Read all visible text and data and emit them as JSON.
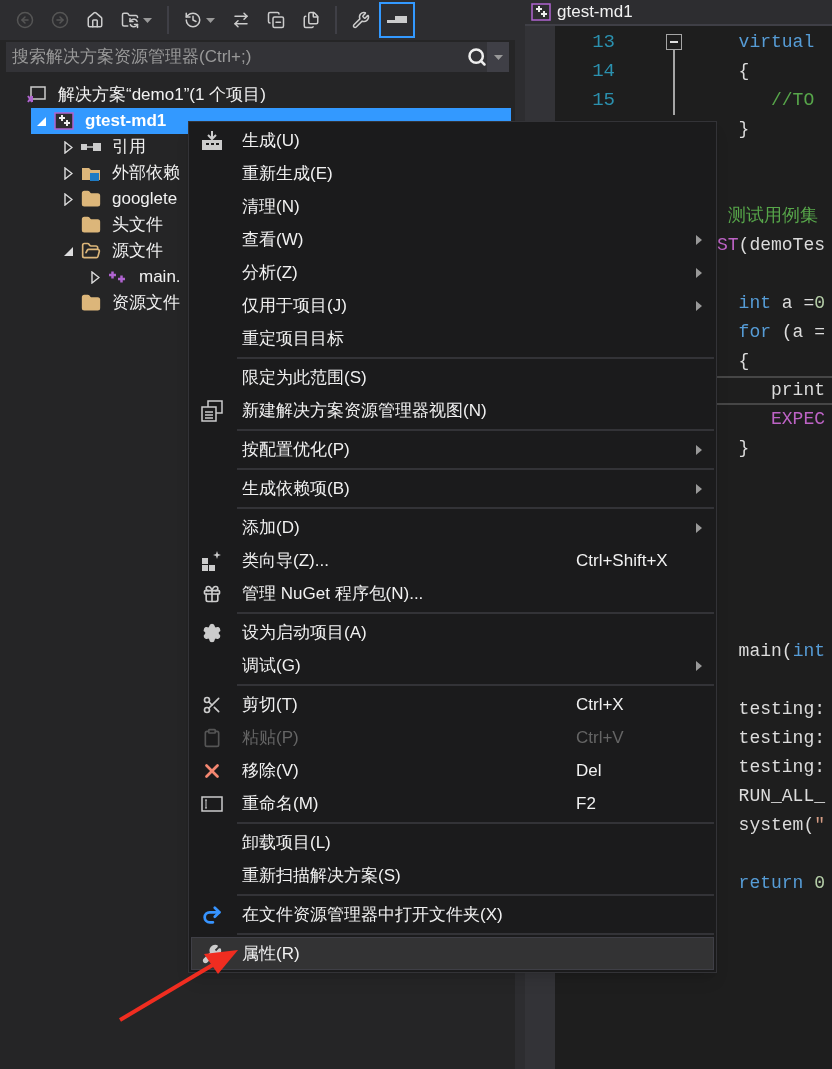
{
  "toolbar": [
    {
      "kind": "back",
      "disabled": true,
      "selected": false,
      "dropdown": false
    },
    {
      "kind": "forward",
      "disabled": true,
      "selected": false,
      "dropdown": false
    },
    {
      "kind": "home",
      "disabled": false,
      "selected": false,
      "dropdown": false
    },
    {
      "kind": "sync",
      "disabled": false,
      "selected": false,
      "dropdown": true
    },
    {
      "kind": "history",
      "disabled": false,
      "selected": false,
      "dropdown": true
    },
    {
      "kind": "swap",
      "disabled": false,
      "selected": false,
      "dropdown": false
    },
    {
      "kind": "collapse",
      "disabled": false,
      "selected": false,
      "dropdown": false
    },
    {
      "kind": "pages",
      "disabled": false,
      "selected": false,
      "dropdown": false
    },
    {
      "kind": "wrench",
      "disabled": false,
      "selected": false,
      "dropdown": false
    },
    {
      "kind": "preview",
      "disabled": false,
      "selected": true,
      "dropdown": false
    }
  ],
  "search": {
    "placeholder": "搜索解决方案资源管理器(Ctrl+;)"
  },
  "tree": [
    {
      "label": "解决方案“demo1”(1 个项目)",
      "kind": "solution",
      "selected": false,
      "children": [
        {
          "label": "gtest-md1",
          "kind": "project",
          "selected": true,
          "expanded": true,
          "children": [
            {
              "label": "引用",
              "kind": "references",
              "selected": false,
              "expanded": false
            },
            {
              "label": "外部依赖",
              "kind": "external",
              "selected": false,
              "expanded": false
            },
            {
              "label": "googlete",
              "kind": "filter",
              "selected": false,
              "expanded": false
            },
            {
              "label": "头文件",
              "kind": "filter",
              "selected": false
            },
            {
              "label": "源文件",
              "kind": "filter-open",
              "selected": false,
              "expanded": true,
              "children": [
                {
                  "label": "main.",
                  "kind": "cpp",
                  "selected": false,
                  "expanded": false
                }
              ]
            },
            {
              "label": "资源文件",
              "kind": "filter",
              "selected": false
            }
          ]
        }
      ]
    }
  ],
  "editor": {
    "tab": "gtest-md1",
    "lines": [
      {
        "kind": "code",
        "number": "13",
        "fold": true,
        "current": false,
        "segments": [
          {
            "t": "  virtual",
            "kind": "keyword"
          }
        ]
      },
      {
        "kind": "code",
        "number": "14",
        "current": false,
        "segments": [
          {
            "t": "  {",
            "kind": "plain"
          }
        ]
      },
      {
        "kind": "code",
        "number": "15",
        "current": false,
        "segments": [
          {
            "t": "     //TO",
            "kind": "comment"
          }
        ]
      },
      {
        "kind": "code",
        "current": false,
        "segments": [
          {
            "t": "  }",
            "kind": "plain"
          }
        ]
      },
      {
        "kind": "blank"
      },
      {
        "kind": "blank"
      },
      {
        "kind": "code",
        "current": false,
        "segments": [
          {
            "t": " 测试用例集",
            "kind": "comment"
          }
        ]
      },
      {
        "kind": "code",
        "current": false,
        "segments": [
          {
            "t": "ST",
            "kind": "macro"
          },
          {
            "t": "(demoTes",
            "kind": "plain"
          }
        ]
      },
      {
        "kind": "blank"
      },
      {
        "kind": "code",
        "current": false,
        "segments": [
          {
            "t": "  int",
            "kind": "keyword"
          },
          {
            "t": " a =",
            "kind": "plain"
          },
          {
            "t": "0",
            "kind": "number"
          }
        ]
      },
      {
        "kind": "code",
        "current": false,
        "segments": [
          {
            "t": "  for",
            "kind": "keyword"
          },
          {
            "t": " (a =",
            "kind": "plain"
          }
        ]
      },
      {
        "kind": "code",
        "current": false,
        "segments": [
          {
            "t": "  {",
            "kind": "plain"
          }
        ]
      },
      {
        "kind": "code",
        "current": true,
        "segments": [
          {
            "t": "     print",
            "kind": "plain"
          }
        ]
      },
      {
        "kind": "code",
        "current": false,
        "segments": [
          {
            "t": "     EXPEC",
            "kind": "macro"
          }
        ]
      },
      {
        "kind": "code",
        "current": false,
        "segments": [
          {
            "t": "  }",
            "kind": "plain"
          }
        ]
      },
      {
        "kind": "blank"
      },
      {
        "kind": "blank"
      },
      {
        "kind": "blank"
      },
      {
        "kind": "blank"
      },
      {
        "kind": "blank"
      },
      {
        "kind": "blank"
      },
      {
        "kind": "code",
        "current": false,
        "segments": [
          {
            "t": "  main(",
            "kind": "plain"
          },
          {
            "t": "int",
            "kind": "keyword"
          }
        ]
      },
      {
        "kind": "blank"
      },
      {
        "kind": "code",
        "current": false,
        "segments": [
          {
            "t": "  testing:",
            "kind": "plain"
          }
        ]
      },
      {
        "kind": "code",
        "current": false,
        "segments": [
          {
            "t": "  testing:",
            "kind": "plain"
          }
        ]
      },
      {
        "kind": "code",
        "current": false,
        "segments": [
          {
            "t": "  testing:",
            "kind": "plain"
          }
        ]
      },
      {
        "kind": "code",
        "current": false,
        "segments": [
          {
            "t": "  RUN_ALL_",
            "kind": "plain"
          }
        ]
      },
      {
        "kind": "code",
        "current": false,
        "segments": [
          {
            "t": "  system(",
            "kind": "plain"
          },
          {
            "t": "\"",
            "kind": "string"
          }
        ]
      },
      {
        "kind": "blank"
      },
      {
        "kind": "code",
        "current": false,
        "segments": [
          {
            "t": "  return",
            "kind": "keyword"
          },
          {
            "t": " 0",
            "kind": "number"
          }
        ]
      }
    ]
  },
  "menu": [
    {
      "kind": "build",
      "label": "生成(U)",
      "submenu": false,
      "disabled": false,
      "selected": false
    },
    {
      "kind": "plain",
      "label": "重新生成(E)",
      "submenu": false,
      "disabled": false,
      "selected": false
    },
    {
      "kind": "plain",
      "label": "清理(N)",
      "submenu": false,
      "disabled": false,
      "selected": false
    },
    {
      "kind": "plain",
      "label": "查看(W)",
      "submenu": true,
      "disabled": false,
      "selected": false
    },
    {
      "kind": "plain",
      "label": "分析(Z)",
      "submenu": true,
      "disabled": false,
      "selected": false
    },
    {
      "kind": "plain",
      "label": "仅用于项目(J)",
      "submenu": true,
      "disabled": false,
      "selected": false
    },
    {
      "kind": "plain",
      "label": "重定项目目标",
      "submenu": false,
      "disabled": false,
      "selected": false
    },
    {
      "kind": "separator"
    },
    {
      "kind": "plain",
      "label": "限定为此范围(S)",
      "submenu": false,
      "disabled": false,
      "selected": false
    },
    {
      "kind": "new-view",
      "label": "新建解决方案资源管理器视图(N)",
      "submenu": false,
      "disabled": false,
      "selected": false
    },
    {
      "kind": "separator"
    },
    {
      "kind": "plain",
      "label": "按配置优化(P)",
      "submenu": true,
      "disabled": false,
      "selected": false
    },
    {
      "kind": "separator"
    },
    {
      "kind": "plain",
      "label": "生成依赖项(B)",
      "submenu": true,
      "disabled": false,
      "selected": false
    },
    {
      "kind": "separator"
    },
    {
      "kind": "plain",
      "label": "添加(D)",
      "submenu": true,
      "disabled": false,
      "selected": false
    },
    {
      "kind": "wizard",
      "label": "类向导(Z)...",
      "shortcut": "Ctrl+Shift+X",
      "submenu": false,
      "disabled": false,
      "selected": false
    },
    {
      "kind": "package",
      "label": "管理 NuGet 程序包(N)...",
      "submenu": false,
      "disabled": false,
      "selected": false
    },
    {
      "kind": "separator"
    },
    {
      "kind": "gear",
      "label": "设为启动项目(A)",
      "submenu": false,
      "disabled": false,
      "selected": false
    },
    {
      "kind": "plain",
      "label": "调试(G)",
      "submenu": true,
      "disabled": false,
      "selected": false
    },
    {
      "kind": "separator"
    },
    {
      "kind": "cut",
      "label": "剪切(T)",
      "shortcut": "Ctrl+X",
      "submenu": false,
      "disabled": false,
      "selected": false
    },
    {
      "kind": "paste",
      "label": "粘贴(P)",
      "shortcut": "Ctrl+V",
      "submenu": false,
      "disabled": true,
      "selected": false
    },
    {
      "kind": "remove",
      "label": "移除(V)",
      "shortcut": "Del",
      "submenu": false,
      "disabled": false,
      "selected": false
    },
    {
      "kind": "rename",
      "label": "重命名(M)",
      "shortcut": "F2",
      "submenu": false,
      "disabled": false,
      "selected": false
    },
    {
      "kind": "separator"
    },
    {
      "kind": "plain",
      "label": "卸载项目(L)",
      "submenu": false,
      "disabled": false,
      "selected": false
    },
    {
      "kind": "plain",
      "label": "重新扫描解决方案(S)",
      "submenu": false,
      "disabled": false,
      "selected": false
    },
    {
      "kind": "separator"
    },
    {
      "kind": "open-folder",
      "label": "在文件资源管理器中打开文件夹(X)",
      "submenu": false,
      "disabled": false,
      "selected": false
    },
    {
      "kind": "separator"
    },
    {
      "kind": "wrench",
      "label": "属性(R)",
      "submenu": false,
      "disabled": false,
      "selected": true
    }
  ]
}
